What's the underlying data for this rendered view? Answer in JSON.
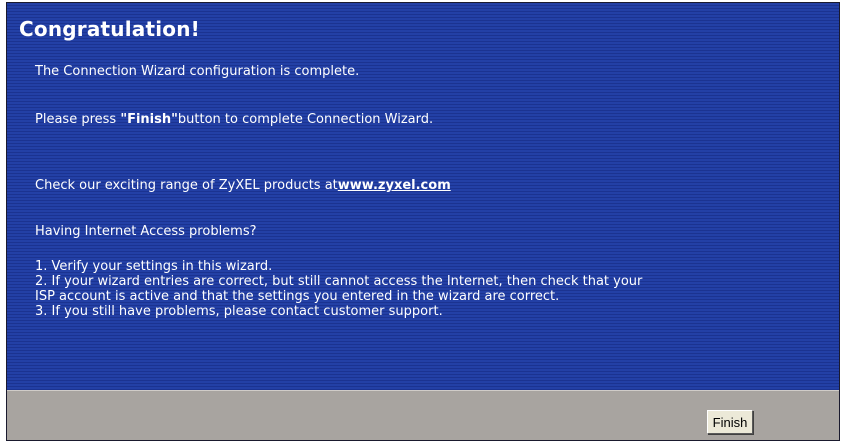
{
  "wizard": {
    "title": "Congratulation!",
    "line_complete": "The Connection Wizard configuration is complete.",
    "press_prefix": "Please press ",
    "press_bold": "\"Finish\"",
    "press_suffix": "button to complete Connection Wizard.",
    "check_prefix": "Check our exciting range of ZyXEL products at",
    "check_link": "www.zyxel.com",
    "problems_heading": "Having Internet Access problems?",
    "steps": [
      "1. Verify your settings in this wizard.",
      "2. If your wizard entries are correct, but still cannot access the Internet, then check that your",
      "ISP account is active and that the settings you entered in the wizard are correct.",
      "3. If you still have problems, please contact customer support."
    ]
  },
  "footer": {
    "finish_label": "Finish"
  },
  "colors": {
    "panel_blue": "#243ea0",
    "footer_gray": "#a8a4a0",
    "text": "#ffffff"
  }
}
